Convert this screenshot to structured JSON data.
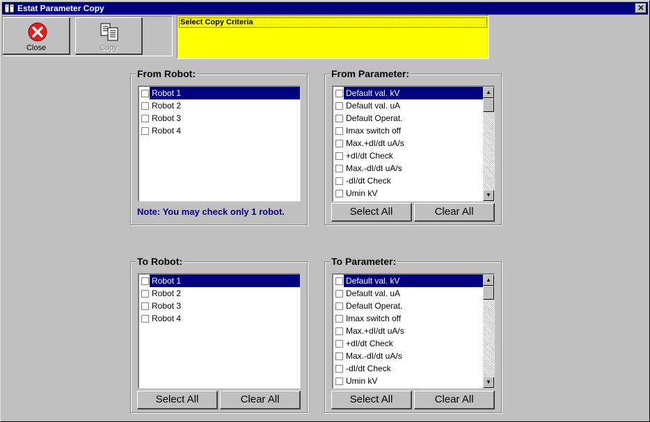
{
  "window": {
    "title": "Estat Parameter Copy"
  },
  "toolbar": {
    "close_label": "Close",
    "copy_label": "Copy"
  },
  "criteria": {
    "text": "Select Copy Criteria"
  },
  "from_robot": {
    "legend": "From Robot:",
    "items": [
      "Robot 1",
      "Robot 2",
      "Robot 3",
      "Robot 4"
    ],
    "selected_index": 0,
    "note": "Note: You may check only 1 robot."
  },
  "from_parameter": {
    "legend": "From Parameter:",
    "items": [
      "Default val. kV",
      "Default val. uA",
      "Default Operat.",
      "Imax switch off",
      "Max.+dI/dt uA/s",
      "+dI/dt Check",
      "Max.-dI/dt uA/s",
      "-dI/dt Check",
      "Umin kV"
    ],
    "selected_index": 0,
    "select_all_label": "Select All",
    "clear_all_label": "Clear All"
  },
  "to_robot": {
    "legend": "To Robot:",
    "items": [
      "Robot 1",
      "Robot 2",
      "Robot 3",
      "Robot 4"
    ],
    "selected_index": 0,
    "select_all_label": "Select All",
    "clear_all_label": "Clear All"
  },
  "to_parameter": {
    "legend": "To Parameter:",
    "items": [
      "Default val. kV",
      "Default val. uA",
      "Default Operat.",
      "Imax switch off",
      "Max.+dI/dt uA/s",
      "+dI/dt Check",
      "Max.-dI/dt uA/s",
      "-dI/dt Check",
      "Umin kV"
    ],
    "selected_index": 0,
    "select_all_label": "Select All",
    "clear_all_label": "Clear All"
  },
  "colors": {
    "face": "#c0c0c0",
    "title_bar": "#000080",
    "criteria_bg": "#ffff00",
    "selection": "#000080",
    "note_text": "#000080",
    "close_icon": "#e02020"
  }
}
